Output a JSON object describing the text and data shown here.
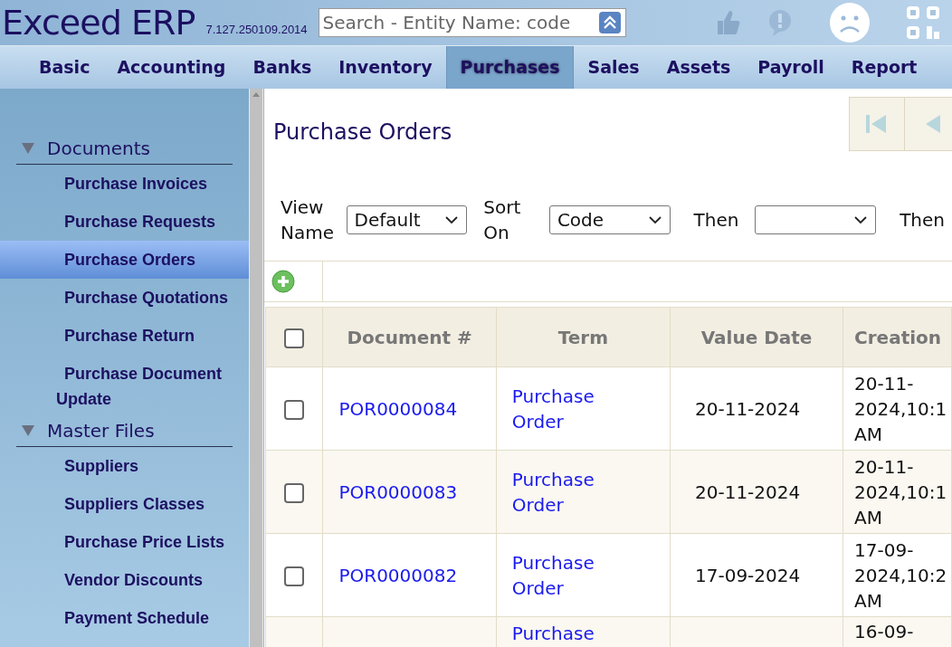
{
  "header": {
    "app_name": "Exceed ERP",
    "version": "7.127.250109.2014",
    "search": {
      "placeholder": "Search - Entity Name: code"
    }
  },
  "nav": [
    {
      "label": "Basic",
      "selected": false
    },
    {
      "label": "Accounting",
      "selected": false
    },
    {
      "label": "Banks",
      "selected": false
    },
    {
      "label": "Inventory",
      "selected": false
    },
    {
      "label": "Purchases",
      "selected": true
    },
    {
      "label": "Sales",
      "selected": false
    },
    {
      "label": "Assets",
      "selected": false
    },
    {
      "label": "Payroll",
      "selected": false
    },
    {
      "label": "Report",
      "selected": false
    }
  ],
  "sidebar": {
    "groups": [
      {
        "title": "Documents",
        "expanded": true,
        "items": [
          {
            "label": "Purchase Invoices",
            "selected": false
          },
          {
            "label": "Purchase Requests",
            "selected": false
          },
          {
            "label": "Purchase Orders",
            "selected": true
          },
          {
            "label": "Purchase Quotations",
            "selected": false
          },
          {
            "label": "Purchase Return",
            "selected": false
          },
          {
            "label": "Purchase Document Update",
            "selected": false
          }
        ]
      },
      {
        "title": "Master Files",
        "expanded": true,
        "items": [
          {
            "label": "Suppliers",
            "selected": false
          },
          {
            "label": "Suppliers Classes",
            "selected": false
          },
          {
            "label": "Purchase Price Lists",
            "selected": false
          },
          {
            "label": "Vendor Discounts",
            "selected": false
          },
          {
            "label": "Payment Schedule",
            "selected": false
          }
        ]
      }
    ]
  },
  "page": {
    "title": "Purchase Orders",
    "filters": [
      {
        "kind": "select",
        "label": "View Name",
        "value": "Default"
      },
      {
        "kind": "select",
        "label": "Sort On",
        "value": "Code"
      },
      {
        "kind": "select",
        "label": "Then"
      },
      {
        "kind": "label",
        "label": "Then"
      }
    ],
    "table": {
      "all_checked": false,
      "columns": [
        "Document #",
        "Term",
        "Value Date",
        "Creation"
      ],
      "rows": [
        {
          "checked": false,
          "document": "POR0000084",
          "term": "Purchase Order",
          "value_date": "20-11-2024",
          "creation": "20-11-2024,10:1 AM"
        },
        {
          "checked": false,
          "document": "POR0000083",
          "term": "Purchase Order",
          "value_date": "20-11-2024",
          "creation": "20-11-2024,10:1 AM"
        },
        {
          "checked": false,
          "document": "POR0000082",
          "term": "Purchase Order",
          "value_date": "17-09-2024",
          "creation": "17-09-2024,10:2 AM"
        },
        {
          "term": "Purchase",
          "creation": "16-09-"
        }
      ]
    }
  }
}
